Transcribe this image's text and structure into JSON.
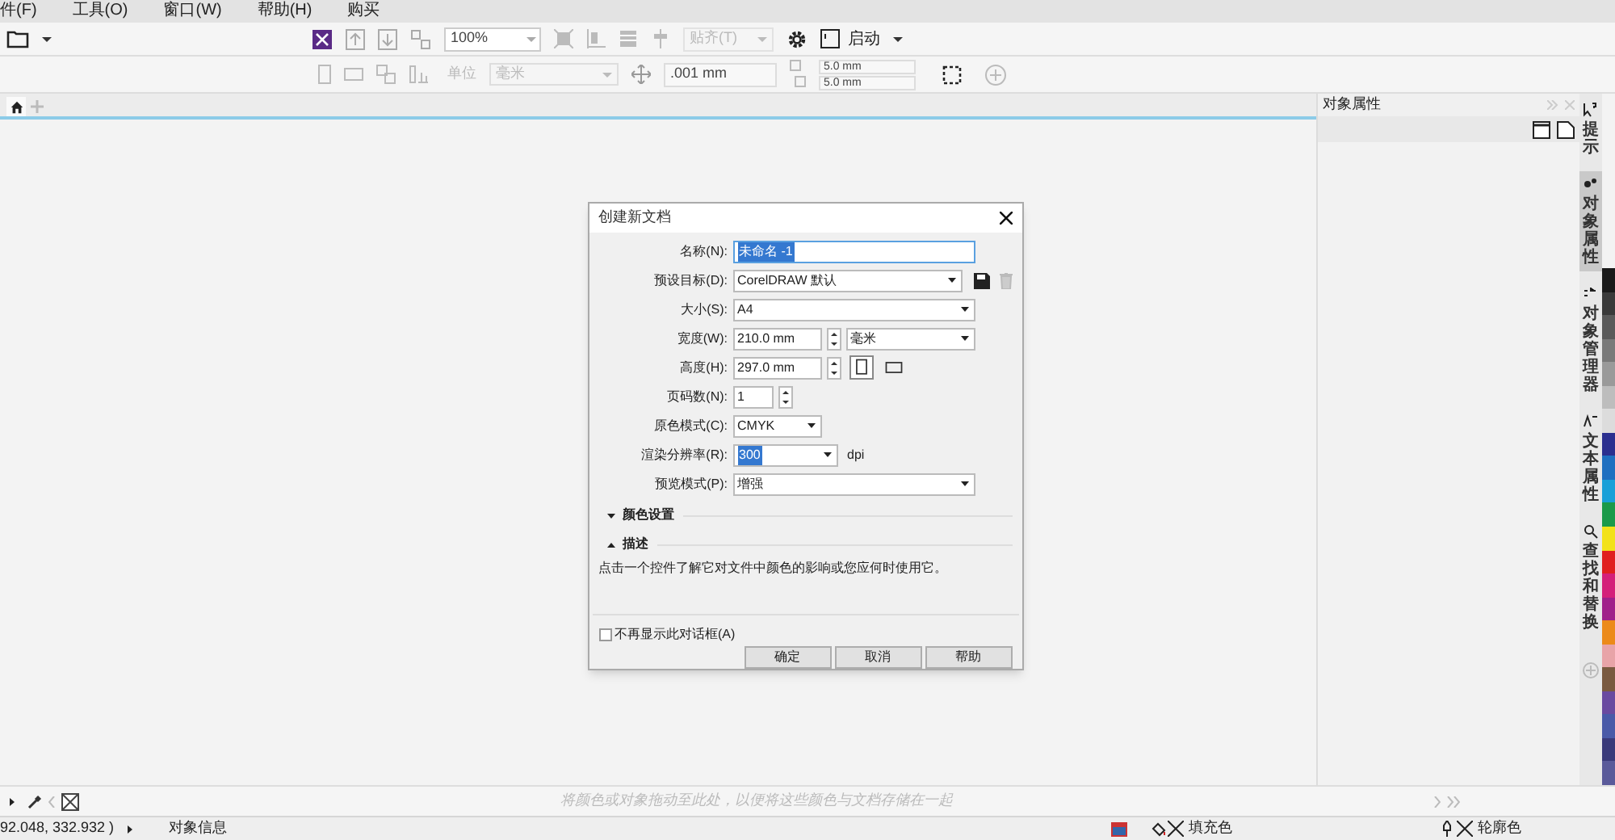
{
  "menu": [
    "件(F)",
    "工具(O)",
    "窗口(W)",
    "帮助(H)",
    "购买"
  ],
  "toolbar": {
    "zoom": "100%",
    "snap": "贴齐(T)",
    "launch": "启动"
  },
  "property_bar": {
    "units_label": "单位",
    "units": "毫米",
    "nudge": ".001 mm",
    "duplicate_x": "5.0 mm",
    "duplicate_y": "5.0 mm"
  },
  "dialog": {
    "title": "创建新文档",
    "fields": [
      {
        "kind": "text",
        "label": "名称(N):",
        "value": "未命名 -1",
        "selected": true
      },
      {
        "kind": "preset",
        "label": "预设目标(D):",
        "value": "CorelDRAW 默认"
      },
      {
        "kind": "combo",
        "label": "大小(S):",
        "value": "A4"
      },
      {
        "kind": "width",
        "label": "宽度(W):",
        "value": "210.0 mm",
        "unit": "毫米"
      },
      {
        "kind": "height",
        "label": "高度(H):",
        "value": "297.0 mm",
        "orientation": [
          {
            "kind": "portrait",
            "selected": true
          },
          {
            "kind": "landscape",
            "selected": false
          }
        ]
      },
      {
        "kind": "spin",
        "label": "页码数(N):",
        "value": "1"
      },
      {
        "kind": "short-combo",
        "label": "原色模式(C):",
        "value": "CMYK"
      },
      {
        "kind": "resolution",
        "label": "渲染分辨率(R):",
        "value": "300",
        "selected": true,
        "suffix": "dpi"
      },
      {
        "kind": "combo",
        "label": "预览模式(P):",
        "value": "增强"
      }
    ],
    "sections": [
      {
        "label": "颜色设置",
        "expanded": false
      },
      {
        "label": "描述",
        "expanded": true
      }
    ],
    "description": "点击一个控件了解它对文件中颜色的影响或您应何时使用它。",
    "checkbox": {
      "label": "不再显示此对话框(A)",
      "checked": false
    },
    "buttons": [
      "确定",
      "取消",
      "帮助"
    ]
  },
  "docker": {
    "title": "对象属性",
    "tabs": [
      {
        "label": "提示",
        "selected": false
      },
      {
        "label": "对象属性",
        "selected": true
      },
      {
        "label": "对象管理器",
        "selected": false
      },
      {
        "label": "文本属性",
        "selected": false
      },
      {
        "label": "查找和替换",
        "selected": false
      }
    ]
  },
  "palette": [
    {
      "color": "#1a1a1a"
    },
    {
      "color": "#3a3a3a"
    },
    {
      "color": "#5a5a5a"
    },
    {
      "color": "#7a7a7a"
    },
    {
      "color": "#9a9a9a"
    },
    {
      "color": "#bdbdbd"
    },
    {
      "color": "#dcdcdc"
    },
    {
      "color": "#2b2f8f"
    },
    {
      "color": "#1f6fc0"
    },
    {
      "color": "#19a0d8"
    },
    {
      "color": "#1b9a4a"
    },
    {
      "color": "#f2e21a"
    },
    {
      "color": "#e0201f"
    },
    {
      "color": "#d4207a"
    },
    {
      "color": "#a0208a"
    },
    {
      "color": "#ec8a1a"
    },
    {
      "color": "#e8a4a8"
    },
    {
      "color": "#7a5a40"
    },
    {
      "color": "#6a4aa0"
    },
    {
      "color": "#4a5aa8"
    },
    {
      "color": "#3a3a7a"
    },
    {
      "color": "#5a5a9a"
    }
  ],
  "color_bar": {
    "hint": "将颜色或对象拖动至此处，以便将这些颜色与文档存储在一起"
  },
  "status_bar": {
    "coords": "92.048, 332.932 )",
    "info": "对象信息",
    "fill": "填充色",
    "outline": "轮廓色"
  }
}
